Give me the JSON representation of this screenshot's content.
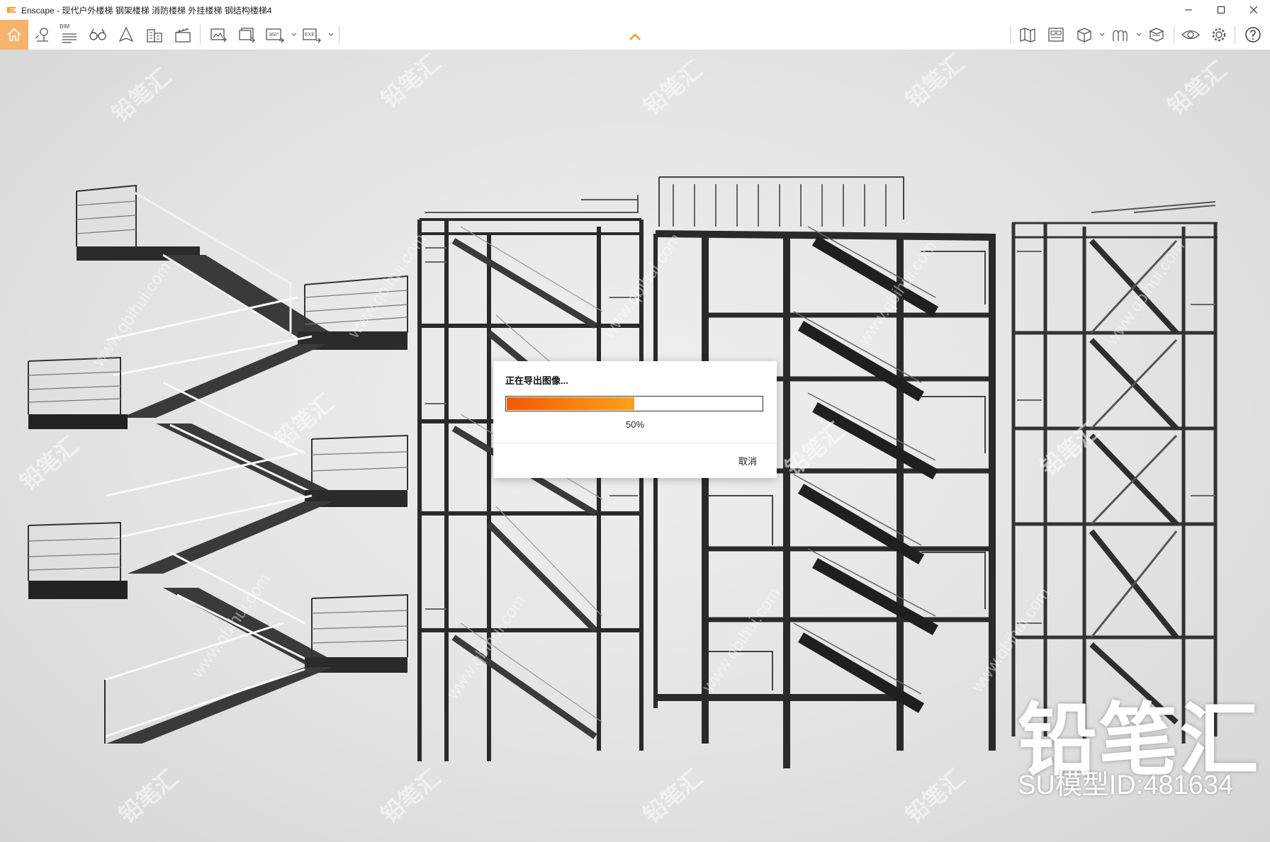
{
  "window": {
    "title": "Enscape - 现代户外楼梯 钢架楼梯 消防楼梯 外挂楼梯 钢结构楼梯4",
    "controls": [
      "minimize",
      "maximize",
      "close"
    ]
  },
  "toolbar": {
    "left_tools": [
      "home-icon",
      "location-pin-icon",
      "bim-icon",
      "binoculars-icon",
      "arrow-cursor-icon",
      "buildings-icon",
      "clapperboard-icon",
      "screenshot-icon",
      "batch-render-icon",
      "panorama-360-icon",
      "exe-export-icon"
    ],
    "bim_label": "BIM",
    "panorama_label": "360°",
    "exe_label": "EXE",
    "right_tools": [
      "map-icon",
      "asset-library-icon",
      "cube-icon",
      "material-icon",
      "box-icon",
      "eye-icon",
      "gear-icon",
      "help-icon"
    ],
    "accent_color": "#f7b26b"
  },
  "dialog": {
    "title": "正在导出图像...",
    "progress_value": 0.5,
    "progress_text": "50%",
    "cancel_label": "取消"
  },
  "watermark": {
    "text": "铅笔汇",
    "url": "www.qbihui.com"
  },
  "brand": {
    "logo_text": "铅笔汇",
    "model_id": "SU模型ID:481634"
  }
}
